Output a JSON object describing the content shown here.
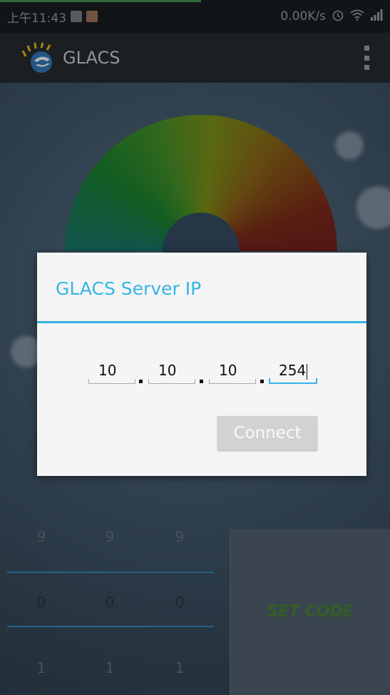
{
  "status_bar": {
    "time": "上午11:43",
    "network_speed": "0.00K/s",
    "icons": [
      "notification-icon",
      "app-icon",
      "alarm-icon",
      "wifi-icon",
      "signal-icon"
    ]
  },
  "action_bar": {
    "app_title": "GLACS",
    "logo": "glacs-logo",
    "menu_icon": "overflow-menu-icon"
  },
  "pickers": {
    "columns": [
      {
        "above": "9",
        "selected": "0",
        "below": "1"
      },
      {
        "above": "9",
        "selected": "0",
        "below": "1"
      },
      {
        "above": "9",
        "selected": "0",
        "below": "1"
      }
    ]
  },
  "set_code_button": "SET CODE",
  "dialog": {
    "title": "GLACS Server IP",
    "ip_octets": [
      "10",
      "10",
      "10",
      "254"
    ],
    "connect_label": "Connect"
  },
  "colors": {
    "accent": "#33b5e5",
    "action_bar": "#1b1b1b",
    "set_code_text": "#3e7d1e"
  }
}
